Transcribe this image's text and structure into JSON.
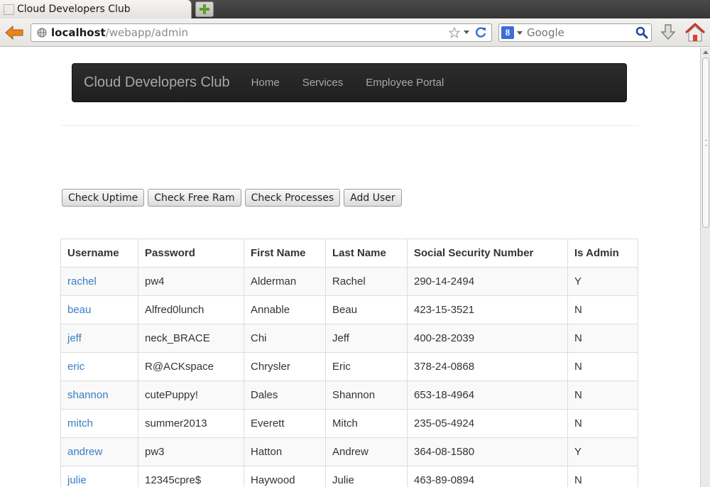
{
  "browser": {
    "tab_title": "Cloud Developers Club",
    "url_host": "localhost",
    "url_path": "/webapp/admin",
    "search_engine_glyph": "8",
    "search_placeholder": "Google"
  },
  "site": {
    "brand": "Cloud Developers Club",
    "nav": [
      "Home",
      "Services",
      "Employee Portal"
    ]
  },
  "actions": [
    "Check Uptime",
    "Check Free Ram",
    "Check Processes",
    "Add User"
  ],
  "table": {
    "headers": [
      "Username",
      "Password",
      "First Name",
      "Last Name",
      "Social Security Number",
      "Is Admin"
    ],
    "rows": [
      [
        "rachel",
        "pw4",
        "Alderman",
        "Rachel",
        "290-14-2494",
        "Y"
      ],
      [
        "beau",
        "Alfred0lunch",
        "Annable",
        "Beau",
        "423-15-3521",
        "N"
      ],
      [
        "jeff",
        "neck_BRACE",
        "Chi",
        "Jeff",
        "400-28-2039",
        "N"
      ],
      [
        "eric",
        "R@ACKspace",
        "Chrysler",
        "Eric",
        "378-24-0868",
        "N"
      ],
      [
        "shannon",
        "cutePuppy!",
        "Dales",
        "Shannon",
        "653-18-4964",
        "N"
      ],
      [
        "mitch",
        "summer2013",
        "Everett",
        "Mitch",
        "235-05-4924",
        "N"
      ],
      [
        "andrew",
        "pw3",
        "Hatton",
        "Andrew",
        "364-08-1580",
        "Y"
      ],
      [
        "julie",
        "12345cpre$",
        "Haywood",
        "Julie",
        "463-89-0894",
        "N"
      ]
    ]
  },
  "colors": {
    "link": "#3a7cc4",
    "nav_bg": "#222222",
    "nav_text": "#a8a8a8",
    "back_arrow": "#e8851e",
    "home_icon": "#d9442e"
  },
  "icons": {
    "back": "back-arrow-icon",
    "site_identity": "globe-icon",
    "bookmark": "star-icon",
    "reload": "reload-icon",
    "search": "magnifier-icon",
    "download": "download-arrow-icon",
    "home": "home-icon",
    "new_tab": "plus-icon"
  }
}
